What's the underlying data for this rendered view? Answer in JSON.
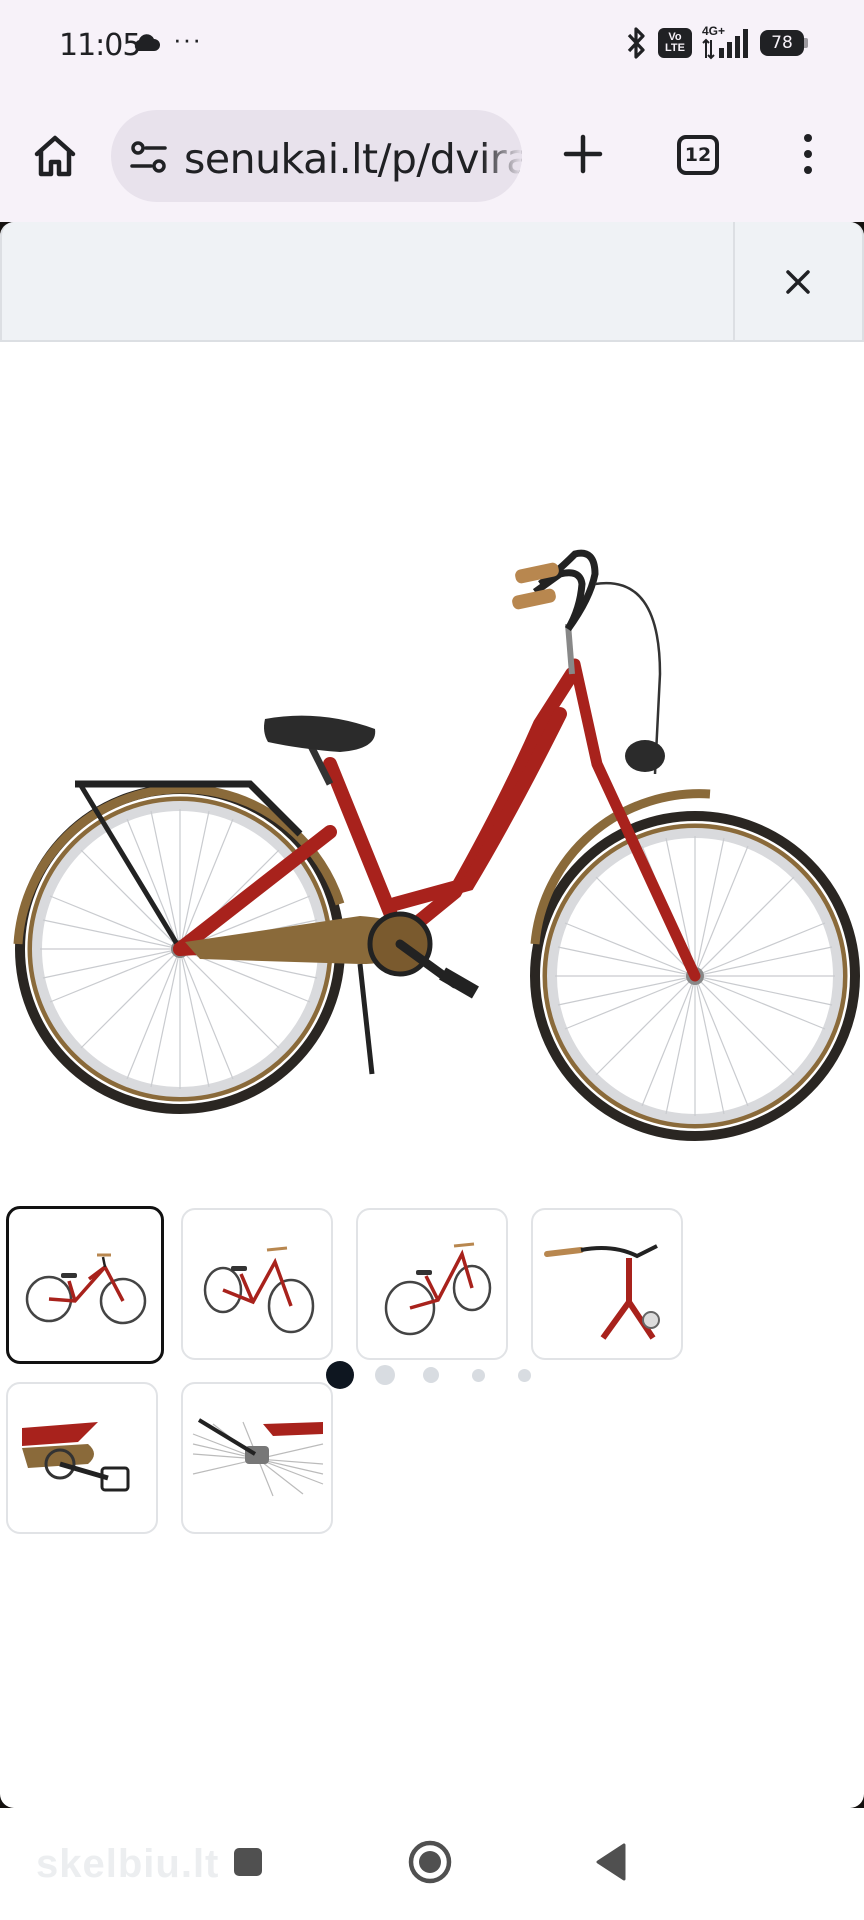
{
  "status_bar": {
    "time": "11:05",
    "more": "···",
    "signal_type": "4G+",
    "volte": "Vo LTE",
    "battery": "78",
    "icons": [
      "cloud-icon",
      "bluetooth-icon",
      "signal-icon",
      "battery-icon"
    ]
  },
  "browser": {
    "url": "senukai.lt/p/dvira",
    "tab_count": "12",
    "icons": [
      "home-icon",
      "site-settings-icon",
      "new-tab-icon",
      "tabs-icon",
      "menu-icon"
    ]
  },
  "gallery": {
    "close_icon": "close-icon",
    "slide_count": 5,
    "active_slide": 1,
    "thumbnails": [
      {
        "view": "side-bike",
        "active": true
      },
      {
        "view": "angled-front-bike",
        "active": false
      },
      {
        "view": "angled-rear-bike",
        "active": false
      },
      {
        "view": "handlebar-closeup",
        "active": false
      },
      {
        "view": "pedal-closeup",
        "active": false
      },
      {
        "view": "rear-hub-closeup",
        "active": false
      }
    ],
    "colors": {
      "frame": "#a8221c",
      "fender": "#8a6a3a",
      "tire": "#2a2622"
    }
  },
  "watermark": {
    "text": "skelbiu.lt"
  },
  "nav_bar": {
    "icons": [
      "recents-icon",
      "home-circle-icon",
      "back-icon"
    ]
  }
}
